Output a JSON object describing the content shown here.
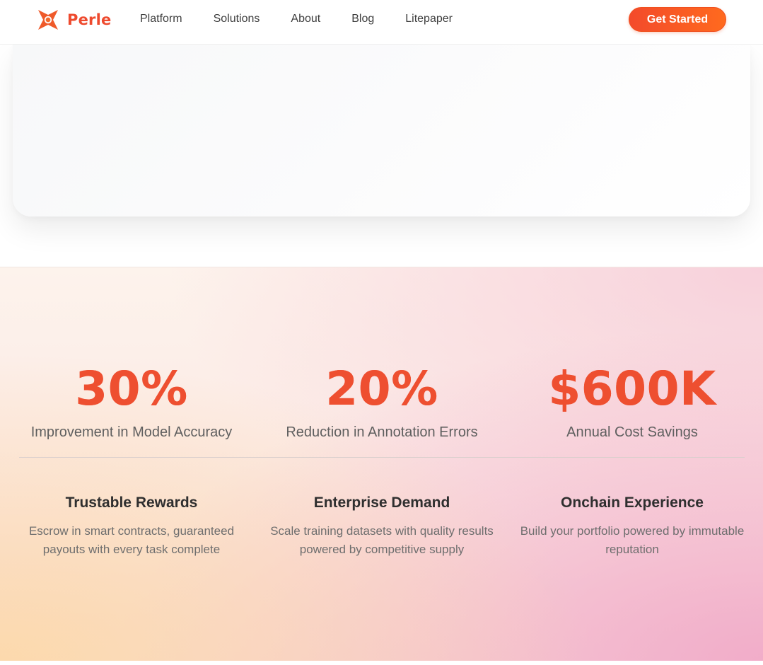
{
  "nav": {
    "brand": "Perle",
    "links": [
      {
        "label": "Platform"
      },
      {
        "label": "Solutions"
      },
      {
        "label": "About"
      },
      {
        "label": "Blog"
      },
      {
        "label": "Litepaper"
      }
    ],
    "cta_label": "Get Started"
  },
  "icons": {
    "logo": "perle-star-logo-icon"
  },
  "colors": {
    "brand": "#ee4a2e",
    "cta_gradient_start": "#f34a2b",
    "cta_gradient_end": "#ff6a1e"
  },
  "stats": [
    {
      "value": "30%",
      "label": "Improvement in Model Accuracy"
    },
    {
      "value": "20%",
      "label": "Reduction in Annotation Errors"
    },
    {
      "value": "$600K",
      "label": "Annual Cost Savings"
    }
  ],
  "features": [
    {
      "title": "Trustable Rewards",
      "desc": "Escrow in smart contracts, guaranteed payouts with every task complete"
    },
    {
      "title": "Enterprise Demand",
      "desc": "Scale training datasets with quality results powered by competitive supply"
    },
    {
      "title": "Onchain Experience",
      "desc": "Build your portfolio powered by immutable reputation"
    }
  ]
}
